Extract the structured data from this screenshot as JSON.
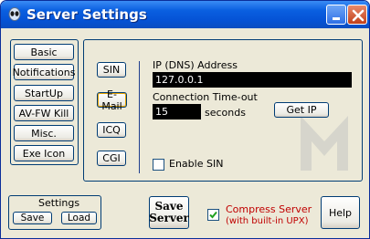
{
  "window": {
    "title": "Server Settings",
    "app_icon": "alien-icon",
    "minimize_icon": "minimize-icon",
    "close_icon": "close-icon"
  },
  "nav": {
    "items": [
      {
        "label": "Basic"
      },
      {
        "label": "Notifications"
      },
      {
        "label": "StartUp"
      },
      {
        "label": "AV-FW Kill"
      },
      {
        "label": "Misc."
      },
      {
        "label": "Exe Icon"
      }
    ]
  },
  "notify_tabs": [
    {
      "label": "SIN"
    },
    {
      "label": "E-Mail"
    },
    {
      "label": "ICQ"
    },
    {
      "label": "CGI"
    }
  ],
  "sin": {
    "ip_label": "IP (DNS) Address",
    "ip_value": "127.0.0.1",
    "timeout_label": "Connection Time-out",
    "timeout_value": "15",
    "timeout_unit": "seconds",
    "get_ip_label": "Get IP",
    "enable_label": "Enable SIN",
    "enable_checked": false
  },
  "settings_group": {
    "title": "Settings",
    "save_label": "Save",
    "load_label": "Load"
  },
  "save_server": {
    "line1": "Save",
    "line2": "Server"
  },
  "compress": {
    "line1": "Compress Server",
    "line2": "(with built-in UPX)",
    "checked": true,
    "color": "#c00000"
  },
  "help_label": "Help"
}
